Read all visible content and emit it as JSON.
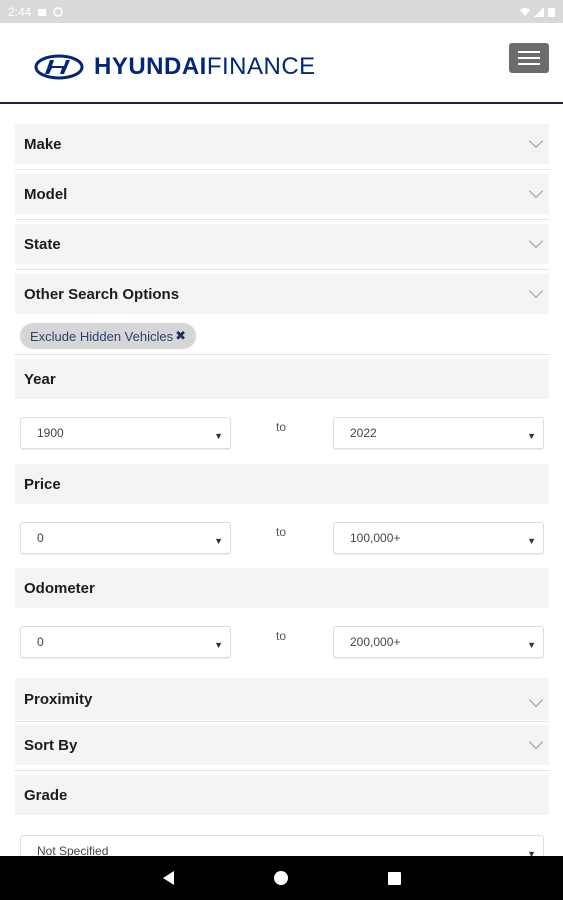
{
  "status_bar": {
    "time": "2:44"
  },
  "header": {
    "brand_bold": "HYUNDAI",
    "brand_thin": "FINANCE",
    "menu_icon": "hamburger-icon"
  },
  "filters": {
    "make": "Make",
    "model": "Model",
    "state": "State",
    "other_options": "Other Search Options",
    "chip_label": "Exclude Hidden Vehicles",
    "chip_remove": "✖",
    "year": {
      "label": "Year",
      "from": "1900",
      "to": "2022",
      "separator": "to"
    },
    "price": {
      "label": "Price",
      "from": "0",
      "to": "100,000+",
      "separator": "to"
    },
    "odometer": {
      "label": "Odometer",
      "from": "0",
      "to": "200,000+",
      "separator": "to"
    },
    "proximity": "Proximity",
    "sort_by": "Sort By",
    "grade": {
      "label": "Grade",
      "value": "Not Specified"
    }
  },
  "colors": {
    "brand": "#00287a",
    "section_bg": "#f4f4f4"
  }
}
